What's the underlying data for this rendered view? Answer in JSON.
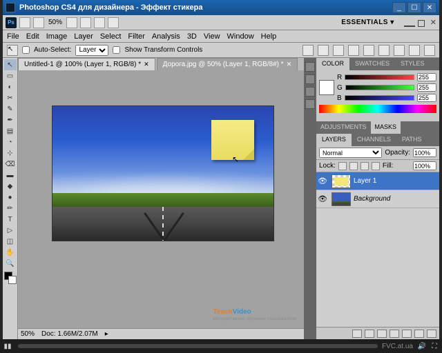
{
  "title": "Photoshop CS4 для дизайнера - Эффект стикера",
  "app_bar": {
    "ps": "Ps",
    "zoom": "50%",
    "workspace": "ESSENTIALS ▾"
  },
  "menu": [
    "File",
    "Edit",
    "Image",
    "Layer",
    "Select",
    "Filter",
    "Analysis",
    "3D",
    "View",
    "Window",
    "Help"
  ],
  "options": {
    "auto_select": "Auto-Select:",
    "auto_mode": "Layer",
    "show_transform": "Show Transform Controls"
  },
  "tabs": [
    {
      "label": "Untitled-1 @ 100% (Layer 1, RGB/8) *",
      "active": false
    },
    {
      "label": "Дорога.jpg @ 50% (Layer 1, RGB/8#) *",
      "active": true
    }
  ],
  "status": {
    "zoom": "50%",
    "doc": "Doc: 1.66M/2.07M"
  },
  "panels": {
    "color": {
      "tabs": [
        "COLOR",
        "SWATCHES",
        "STYLES"
      ],
      "r": 255,
      "g": 255,
      "b": 255
    },
    "adjust": {
      "tabs": [
        "ADJUSTMENTS",
        "MASKS"
      ]
    },
    "layers": {
      "tabs": [
        "LAYERS",
        "CHANNELS",
        "PATHS"
      ],
      "blend": "Normal",
      "opacity_label": "Opacity:",
      "opacity": "100%",
      "lock_label": "Lock:",
      "fill_label": "Fill:",
      "fill": "100%",
      "items": [
        {
          "name": "Layer 1",
          "selected": true
        },
        {
          "name": "Background",
          "selected": false,
          "italic": true
        }
      ]
    }
  },
  "tools": [
    "↖",
    "▭",
    "◐",
    "✂",
    "✎",
    "✒",
    "▤",
    "◔",
    "⊹",
    "⌫",
    "▬",
    "◆",
    "●",
    "✏",
    "T",
    "▷",
    "◫",
    "✋",
    "🔍"
  ],
  "watermark": {
    "t": "Teach",
    "v": "Video",
    "sub": "Интерактивное обучение пользователю"
  },
  "player": {
    "site": "FVC.at.ua"
  }
}
